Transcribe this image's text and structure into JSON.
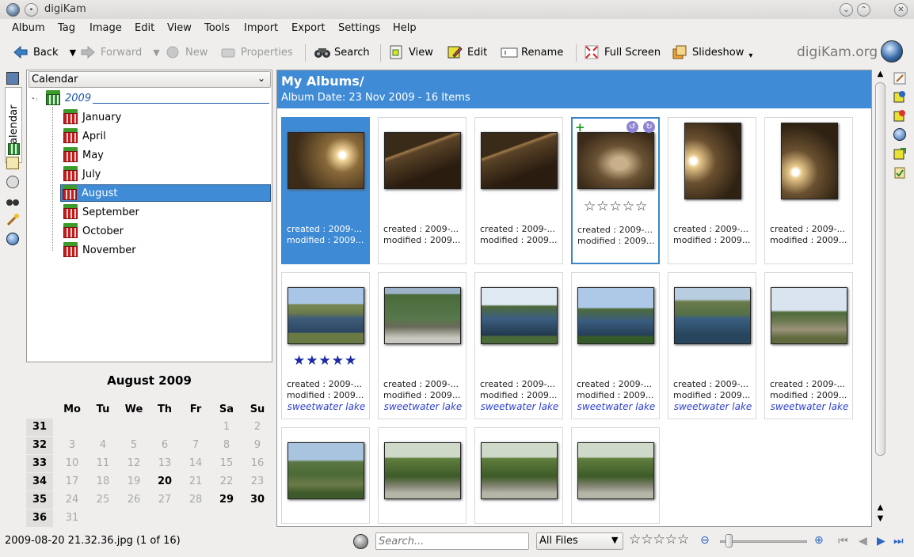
{
  "window": {
    "title": "digiKam"
  },
  "menu": [
    "Album",
    "Tag",
    "Image",
    "Edit",
    "View",
    "Tools",
    "Import",
    "Export",
    "Settings",
    "Help"
  ],
  "toolbar": {
    "back": "Back",
    "forward": "Forward",
    "new": "New",
    "properties": "Properties",
    "search": "Search",
    "view": "View",
    "edit": "Edit",
    "rename": "Rename",
    "fullscreen": "Full Screen",
    "slideshow": "Slideshow",
    "brand": "digiKam.org"
  },
  "sidebar": {
    "tab_label": "Calendar",
    "combo_value": "Calendar"
  },
  "tree": {
    "year": "2009",
    "months": [
      "January",
      "April",
      "May",
      "July",
      "August",
      "September",
      "October",
      "November"
    ],
    "selected": "August"
  },
  "calendar": {
    "title": "August 2009",
    "days": [
      "Mo",
      "Tu",
      "We",
      "Th",
      "Fr",
      "Sa",
      "Su"
    ],
    "weeks": [
      "31",
      "32",
      "33",
      "34",
      "35",
      "36"
    ],
    "rows": [
      [
        "",
        "",
        "",
        "",
        "",
        "1",
        "2"
      ],
      [
        "3",
        "4",
        "5",
        "6",
        "7",
        "8",
        "9"
      ],
      [
        "10",
        "11",
        "12",
        "13",
        "14",
        "15",
        "16"
      ],
      [
        "17",
        "18",
        "19",
        "20",
        "21",
        "22",
        "23"
      ],
      [
        "24",
        "25",
        "26",
        "27",
        "28",
        "29",
        "30"
      ],
      [
        "31",
        "",
        "",
        "",
        "",
        "",
        ""
      ]
    ],
    "bold_days": [
      "20",
      "29",
      "30"
    ]
  },
  "album": {
    "title": "My Albums/",
    "subtitle": "Album Date: 23 Nov 2009 - 16 Items"
  },
  "thumbnails": [
    {
      "created": "created : 2009-...",
      "modified": "modified : 2009...",
      "tag": ""
    },
    {
      "created": "created : 2009-...",
      "modified": "modified : 2009...",
      "tag": ""
    },
    {
      "created": "created : 2009-...",
      "modified": "modified : 2009...",
      "tag": ""
    },
    {
      "created": "created : 2009-...",
      "modified": "modified : 2009...",
      "tag": "",
      "rating": 0
    },
    {
      "created": "created : 2009-...",
      "modified": "modified : 2009...",
      "tag": ""
    },
    {
      "created": "created : 2009-...",
      "modified": "modified : 2009...",
      "tag": ""
    },
    {
      "created": "created : 2009-...",
      "modified": "modified : 2009...",
      "tag": "sweetwater lake",
      "rating": 5
    },
    {
      "created": "created : 2009-...",
      "modified": "modified : 2009...",
      "tag": "sweetwater lake"
    },
    {
      "created": "created : 2009-...",
      "modified": "modified : 2009...",
      "tag": "sweetwater lake"
    },
    {
      "created": "created : 2009-...",
      "modified": "modified : 2009...",
      "tag": "sweetwater lake"
    },
    {
      "created": "created : 2009-...",
      "modified": "modified : 2009...",
      "tag": "sweetwater lake"
    },
    {
      "created": "created : 2009-...",
      "modified": "modified : 2009...",
      "tag": "sweetwater lake"
    },
    {
      "created": "",
      "modified": "",
      "tag": ""
    },
    {
      "created": "",
      "modified": "",
      "tag": ""
    },
    {
      "created": "",
      "modified": "",
      "tag": ""
    },
    {
      "created": "",
      "modified": "",
      "tag": ""
    }
  ],
  "status": {
    "file": "2009-08-20 21.32.36.jpg (1 of 16)",
    "search_placeholder": "Search...",
    "filter": "All Files",
    "zoom_level": 0.06
  },
  "colors": {
    "accent": "#3f8bd6",
    "tag": "#2b3fd0"
  }
}
